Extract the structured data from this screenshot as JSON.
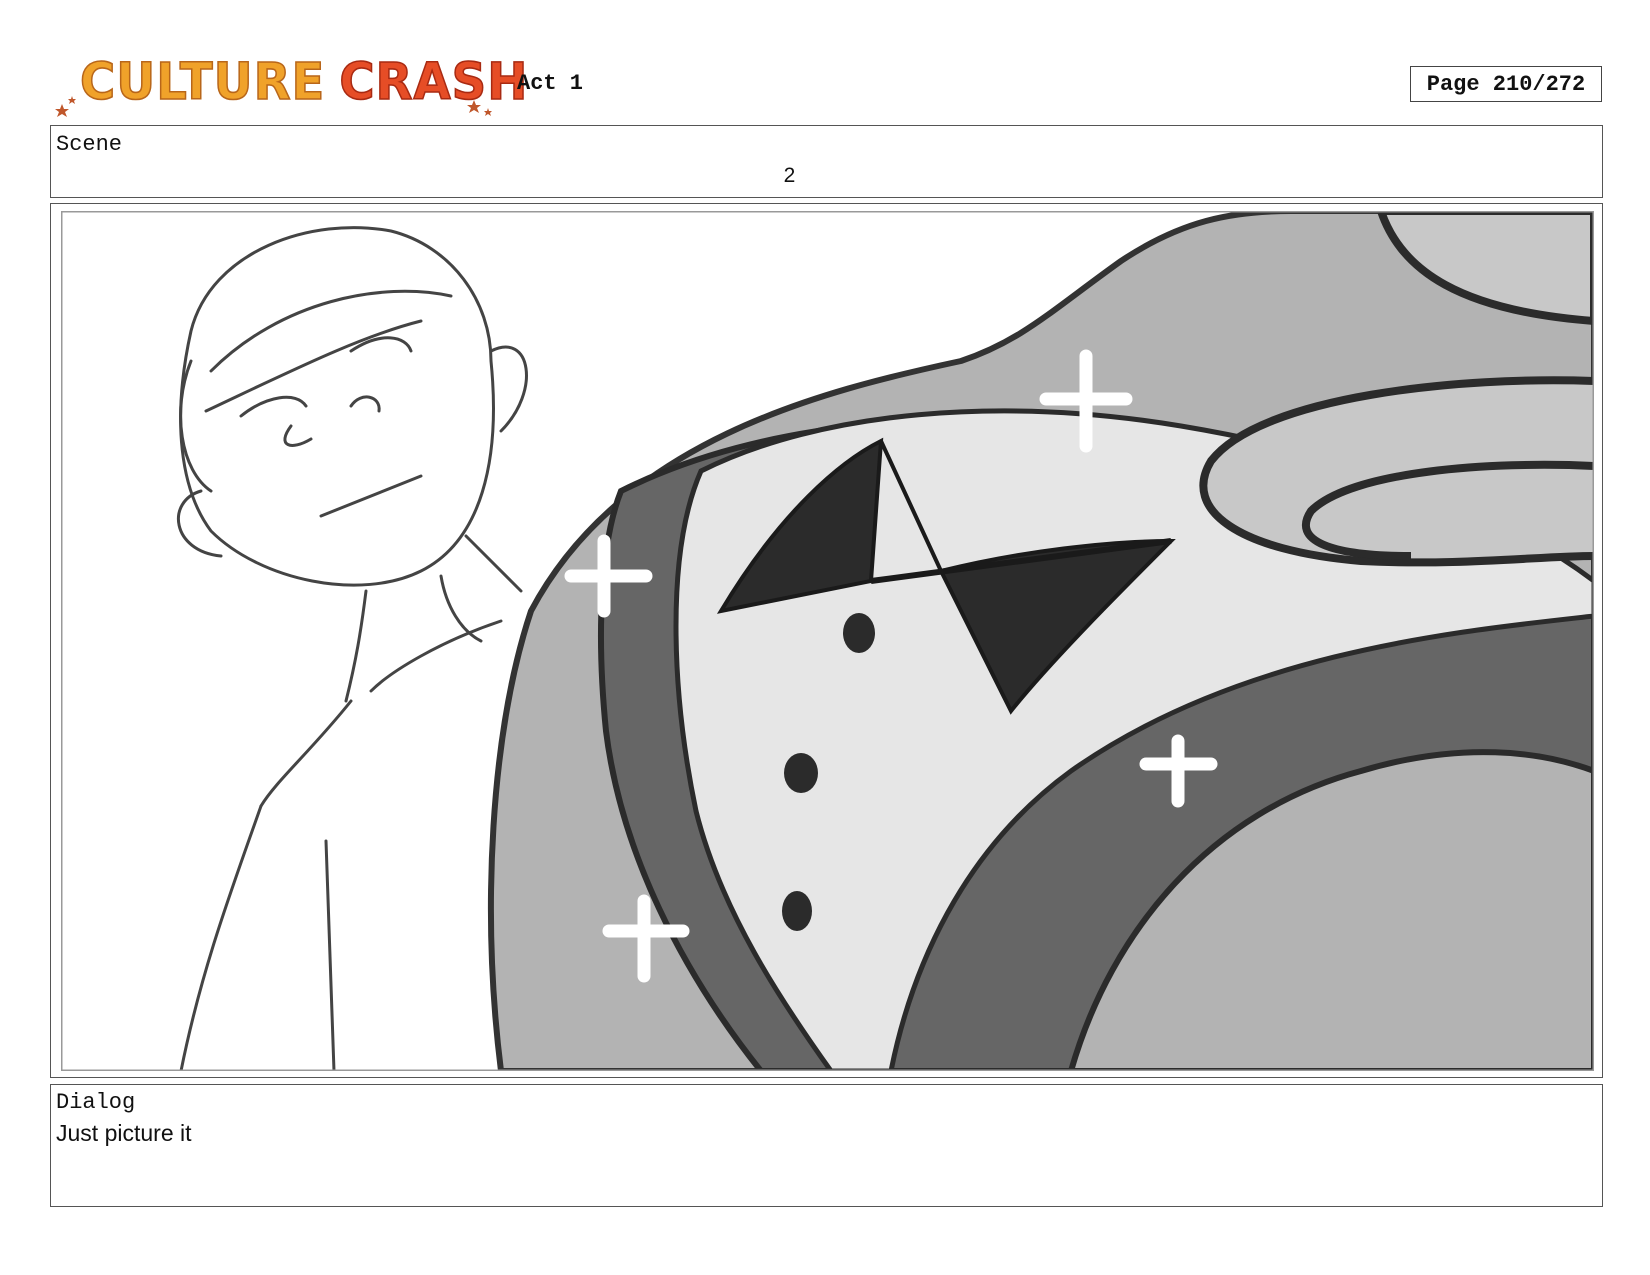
{
  "header": {
    "logo": {
      "word1": "CULTURE",
      "word2": "CRASH"
    },
    "act": "Act 1",
    "page": "Page 210/272"
  },
  "scene": {
    "label": "Scene",
    "number": "2"
  },
  "panel": {
    "subject": "storyboard-sketch",
    "colors": {
      "light_gray": "#e6e6e6",
      "mid_gray": "#b3b3b3",
      "dark_gray": "#666666",
      "ink": "#2b2b2b"
    }
  },
  "dialog": {
    "label": "Dialog",
    "text": "Just picture it"
  },
  "logo_colors": {
    "orange": "#f0a22a",
    "red": "#e64d26",
    "star": "#c0572b"
  }
}
